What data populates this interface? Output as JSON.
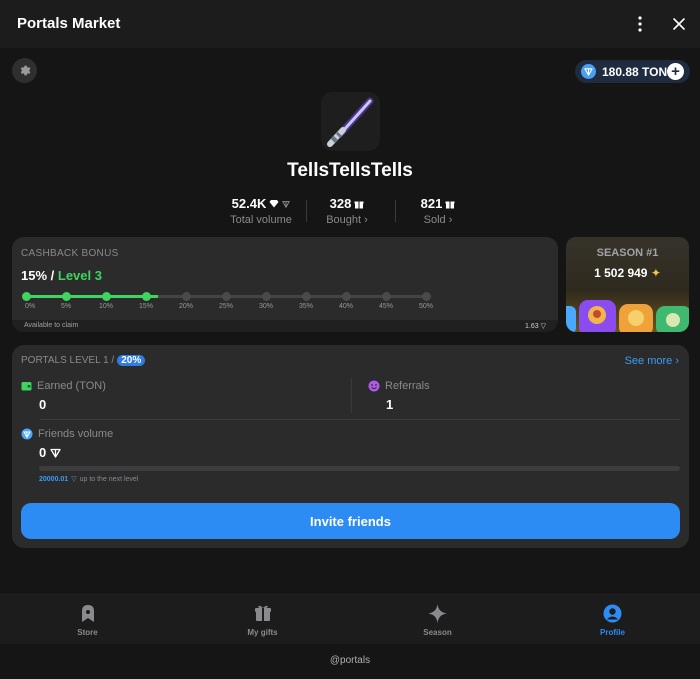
{
  "header": {
    "title": "Portals Market"
  },
  "balance": {
    "amount": "180.88 TON"
  },
  "profile": {
    "username": "TellsTellsTells"
  },
  "stats": [
    {
      "value": "52.4K",
      "label": "Total volume"
    },
    {
      "value": "328",
      "label": "Bought ›"
    },
    {
      "value": "821",
      "label": "Sold ›"
    }
  ],
  "cashback": {
    "caption": "CASHBACK BONUS",
    "percent": "15% /",
    "level": "Level 3",
    "ticks": [
      "0%",
      "5%",
      "10%",
      "15%",
      "20%",
      "25%",
      "30%",
      "35%",
      "40%",
      "45%",
      "50%"
    ],
    "progress_fraction": 0.33,
    "available_label": "Available to claim",
    "available_value": "1.63"
  },
  "season": {
    "title": "SEASON #1",
    "points": "1 502 949"
  },
  "portals": {
    "caption": "PORTALS LEVEL 1 /",
    "badge": "20%",
    "see_more": "See more ›",
    "earned_label": "Earned (TON)",
    "earned_value": "0",
    "referrals_label": "Referrals",
    "referrals_value": "1",
    "friends_label": "Friends volume",
    "friends_value": "0",
    "next_value": "20000.01",
    "next_label": "up to the next level",
    "invite_label": "Invite friends"
  },
  "tabs": [
    {
      "label": "Store"
    },
    {
      "label": "My gifts"
    },
    {
      "label": "Season"
    },
    {
      "label": "Profile"
    }
  ],
  "footer": {
    "handle": "@portals"
  },
  "colors": {
    "accent": "#2c8cf4",
    "green": "#3fd35f",
    "background": "#151515",
    "card": "#2b2b2c"
  }
}
